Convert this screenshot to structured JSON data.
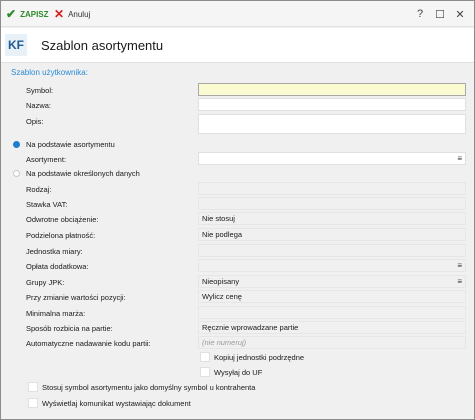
{
  "toolbar": {
    "save_label": "ZAPISZ",
    "cancel_label": "Anuluj"
  },
  "window_controls": {
    "help": "?",
    "maximize": "☐",
    "close": "✕"
  },
  "header": {
    "logo": "KF",
    "title": "Szablon asortymentu"
  },
  "form": {
    "section_title": "Szablon użytkownika:",
    "symbol_label": "Symbol:",
    "nazwa_label": "Nazwa:",
    "opis_label": "Opis:",
    "radio_asortyment_label": "Na podstawie asortymentu",
    "asortyment_label": "Asortyment:",
    "radio_dane_label": "Na podstawie określonych danych",
    "rodzaj_label": "Rodzaj:",
    "stawka_vat_label": "Stawka VAT:",
    "odwrotne_label": "Odwrotne obciążenie:",
    "odwrotne_value": "Nie stosuj",
    "podzielona_label": "Podzielona płatność:",
    "podzielona_value": "Nie podlega",
    "jednostka_label": "Jednostka miary:",
    "oplata_label": "Opłata dodatkowa:",
    "grupy_jpk_label": "Grupy JPK:",
    "grupy_jpk_value": "Nieopisany",
    "zmiana_label": "Przy zmianie wartości pozycji:",
    "zmiana_value": "Wylicz cenę",
    "marza_label": "Minimalna marża:",
    "rozbicie_label": "Sposób rozbicia na partie:",
    "rozbicie_value": "Ręcznie wprowadzane partie",
    "kod_partii_label": "Automatyczne nadawanie kodu partii:",
    "kod_partii_placeholder": "(nie numeruj)",
    "kopiuj_label": "Kopiuj jednostki podrzędne",
    "wysylaj_label": "Wysyłaj do UF",
    "stosuj_label": "Stosuj symbol asortymentu jako domyślny symbol u kontrahenta",
    "wyswietlaj_label": "Wyświetlaj komunikat wystawiając dokument"
  },
  "icons": {
    "save": "check-icon",
    "cancel": "x-icon",
    "list": "list-icon"
  },
  "colors": {
    "accent": "#2a8bd6",
    "save_green": "#2e8b2e",
    "cancel_red": "#d42020",
    "required_field": "#fbfbd1"
  }
}
